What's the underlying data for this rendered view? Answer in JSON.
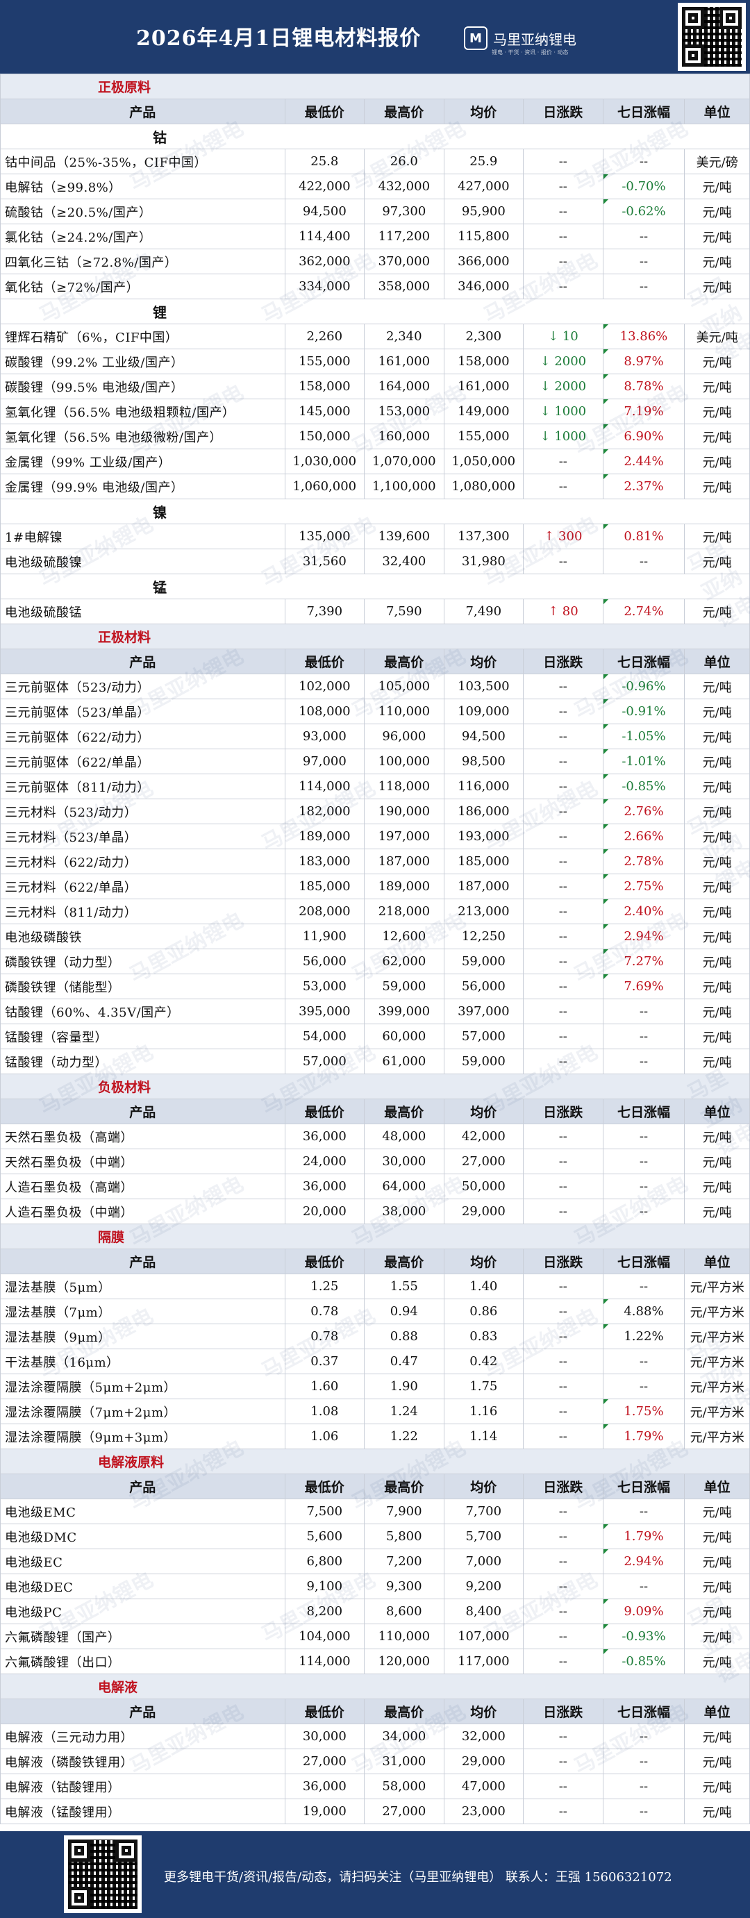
{
  "header": {
    "title": "2026年4月1日锂电材料报价",
    "brand": "马里亚纳锂电",
    "brand_sub": "锂电 · 干货 · 资讯 · 报价 · 动态",
    "qr_icon": "qr-code"
  },
  "footer": {
    "text": "更多锂电干货/资讯/报告/动态，请扫码关注（马里亚纳锂电） 联系人：王强 15606321072",
    "qr_icon": "qr-code"
  },
  "watermark": "马里亚纳锂电",
  "columns": [
    "产品",
    "最低价",
    "最高价",
    "均价",
    "日涨跌",
    "七日涨幅",
    "单位"
  ],
  "sections": [
    {
      "title": "正极原料",
      "groups": [
        {
          "name": "钴",
          "rows": [
            {
              "name": "钴中间品（25%-35%，CIF中国）",
              "low": "25.8",
              "high": "26.0",
              "avg": "25.9",
              "day": "--",
              "dayDir": "",
              "week": "--",
              "weekDir": "",
              "unit": "美元/磅"
            },
            {
              "name": "电解钴（≥99.8%）",
              "low": "422,000",
              "high": "432,000",
              "avg": "427,000",
              "day": "--",
              "dayDir": "",
              "week": "-0.70%",
              "weekDir": "down",
              "unit": "元/吨"
            },
            {
              "name": "硫酸钴（≥20.5%/国产）",
              "low": "94,500",
              "high": "97,300",
              "avg": "95,900",
              "day": "--",
              "dayDir": "",
              "week": "-0.62%",
              "weekDir": "down",
              "unit": "元/吨"
            },
            {
              "name": "氯化钴（≥24.2%/国产）",
              "low": "114,400",
              "high": "117,200",
              "avg": "115,800",
              "day": "--",
              "dayDir": "",
              "week": "--",
              "weekDir": "",
              "unit": "元/吨"
            },
            {
              "name": "四氧化三钴（≥72.8%/国产）",
              "low": "362,000",
              "high": "370,000",
              "avg": "366,000",
              "day": "--",
              "dayDir": "",
              "week": "--",
              "weekDir": "",
              "unit": "元/吨"
            },
            {
              "name": "氧化钴（≥72%/国产）",
              "low": "334,000",
              "high": "358,000",
              "avg": "346,000",
              "day": "--",
              "dayDir": "",
              "week": "--",
              "weekDir": "",
              "unit": "元/吨"
            }
          ]
        },
        {
          "name": "锂",
          "rows": [
            {
              "name": "锂辉石精矿（6%，CIF中国）",
              "low": "2,260",
              "high": "2,340",
              "avg": "2,300",
              "day": "10",
              "dayDir": "down",
              "week": "13.86%",
              "weekDir": "up",
              "unit": "美元/吨"
            },
            {
              "name": "碳酸锂（99.2% 工业级/国产）",
              "low": "155,000",
              "high": "161,000",
              "avg": "158,000",
              "day": "2000",
              "dayDir": "down",
              "week": "8.97%",
              "weekDir": "up",
              "unit": "元/吨"
            },
            {
              "name": "碳酸锂（99.5% 电池级/国产）",
              "low": "158,000",
              "high": "164,000",
              "avg": "161,000",
              "day": "2000",
              "dayDir": "down",
              "week": "8.78%",
              "weekDir": "up",
              "unit": "元/吨"
            },
            {
              "name": "氢氧化锂（56.5% 电池级粗颗粒/国产）",
              "low": "145,000",
              "high": "153,000",
              "avg": "149,000",
              "day": "1000",
              "dayDir": "down",
              "week": "7.19%",
              "weekDir": "up",
              "unit": "元/吨"
            },
            {
              "name": "氢氧化锂（56.5% 电池级微粉/国产）",
              "low": "150,000",
              "high": "160,000",
              "avg": "155,000",
              "day": "1000",
              "dayDir": "down",
              "week": "6.90%",
              "weekDir": "up",
              "unit": "元/吨"
            },
            {
              "name": "金属锂（99% 工业级/国产）",
              "low": "1,030,000",
              "high": "1,070,000",
              "avg": "1,050,000",
              "day": "--",
              "dayDir": "",
              "week": "2.44%",
              "weekDir": "up",
              "unit": "元/吨"
            },
            {
              "name": "金属锂（99.9% 电池级/国产）",
              "low": "1,060,000",
              "high": "1,100,000",
              "avg": "1,080,000",
              "day": "--",
              "dayDir": "",
              "week": "2.37%",
              "weekDir": "up",
              "unit": "元/吨"
            }
          ]
        },
        {
          "name": "镍",
          "rows": [
            {
              "name": "1#电解镍",
              "low": "135,000",
              "high": "139,600",
              "avg": "137,300",
              "day": "300",
              "dayDir": "up",
              "week": "0.81%",
              "weekDir": "up",
              "unit": "元/吨"
            },
            {
              "name": "电池级硫酸镍",
              "low": "31,560",
              "high": "32,400",
              "avg": "31,980",
              "day": "--",
              "dayDir": "",
              "week": "--",
              "weekDir": "",
              "unit": "元/吨"
            }
          ]
        },
        {
          "name": "锰",
          "rows": [
            {
              "name": "电池级硫酸锰",
              "low": "7,390",
              "high": "7,590",
              "avg": "7,490",
              "day": "80",
              "dayDir": "up",
              "week": "2.74%",
              "weekDir": "up",
              "unit": "元/吨"
            }
          ]
        }
      ]
    },
    {
      "title": "正极材料",
      "showHeader": true,
      "groups": [
        {
          "name": "",
          "rows": [
            {
              "name": "三元前驱体（523/动力）",
              "low": "102,000",
              "high": "105,000",
              "avg": "103,500",
              "day": "--",
              "dayDir": "",
              "week": "-0.96%",
              "weekDir": "down",
              "unit": "元/吨"
            },
            {
              "name": "三元前驱体（523/单晶）",
              "low": "108,000",
              "high": "110,000",
              "avg": "109,000",
              "day": "--",
              "dayDir": "",
              "week": "-0.91%",
              "weekDir": "down",
              "unit": "元/吨"
            },
            {
              "name": "三元前驱体（622/动力）",
              "low": "93,000",
              "high": "96,000",
              "avg": "94,500",
              "day": "--",
              "dayDir": "",
              "week": "-1.05%",
              "weekDir": "down",
              "unit": "元/吨"
            },
            {
              "name": "三元前驱体（622/单晶）",
              "low": "97,000",
              "high": "100,000",
              "avg": "98,500",
              "day": "--",
              "dayDir": "",
              "week": "-1.01%",
              "weekDir": "down",
              "unit": "元/吨"
            },
            {
              "name": "三元前驱体（811/动力）",
              "low": "114,000",
              "high": "118,000",
              "avg": "116,000",
              "day": "--",
              "dayDir": "",
              "week": "-0.85%",
              "weekDir": "down",
              "unit": "元/吨"
            },
            {
              "name": "三元材料（523/动力）",
              "low": "182,000",
              "high": "190,000",
              "avg": "186,000",
              "day": "--",
              "dayDir": "",
              "week": "2.76%",
              "weekDir": "up",
              "unit": "元/吨"
            },
            {
              "name": "三元材料（523/单晶）",
              "low": "189,000",
              "high": "197,000",
              "avg": "193,000",
              "day": "--",
              "dayDir": "",
              "week": "2.66%",
              "weekDir": "up",
              "unit": "元/吨"
            },
            {
              "name": "三元材料（622/动力）",
              "low": "183,000",
              "high": "187,000",
              "avg": "185,000",
              "day": "--",
              "dayDir": "",
              "week": "2.78%",
              "weekDir": "up",
              "unit": "元/吨"
            },
            {
              "name": "三元材料（622/单晶）",
              "low": "185,000",
              "high": "189,000",
              "avg": "187,000",
              "day": "--",
              "dayDir": "",
              "week": "2.75%",
              "weekDir": "up",
              "unit": "元/吨"
            },
            {
              "name": "三元材料（811/动力）",
              "low": "208,000",
              "high": "218,000",
              "avg": "213,000",
              "day": "--",
              "dayDir": "",
              "week": "2.40%",
              "weekDir": "up",
              "unit": "元/吨"
            },
            {
              "name": "电池级磷酸铁",
              "low": "11,900",
              "high": "12,600",
              "avg": "12,250",
              "day": "--",
              "dayDir": "",
              "week": "2.94%",
              "weekDir": "up",
              "unit": "元/吨"
            },
            {
              "name": "磷酸铁锂（动力型）",
              "low": "56,000",
              "high": "62,000",
              "avg": "59,000",
              "day": "--",
              "dayDir": "",
              "week": "7.27%",
              "weekDir": "up",
              "unit": "元/吨"
            },
            {
              "name": "磷酸铁锂（储能型）",
              "low": "53,000",
              "high": "59,000",
              "avg": "56,000",
              "day": "--",
              "dayDir": "",
              "week": "7.69%",
              "weekDir": "up",
              "unit": "元/吨"
            },
            {
              "name": "钴酸锂（60%、4.35V/国产）",
              "low": "395,000",
              "high": "399,000",
              "avg": "397,000",
              "day": "--",
              "dayDir": "",
              "week": "--",
              "weekDir": "",
              "unit": "元/吨"
            },
            {
              "name": "锰酸锂（容量型）",
              "low": "54,000",
              "high": "60,000",
              "avg": "57,000",
              "day": "--",
              "dayDir": "",
              "week": "--",
              "weekDir": "",
              "unit": "元/吨"
            },
            {
              "name": "锰酸锂（动力型）",
              "low": "57,000",
              "high": "61,000",
              "avg": "59,000",
              "day": "--",
              "dayDir": "",
              "week": "--",
              "weekDir": "",
              "unit": "元/吨"
            }
          ]
        }
      ]
    },
    {
      "title": "负极材料",
      "showHeader": true,
      "groups": [
        {
          "name": "",
          "rows": [
            {
              "name": "天然石墨负极（高端）",
              "low": "36,000",
              "high": "48,000",
              "avg": "42,000",
              "day": "--",
              "dayDir": "",
              "week": "--",
              "weekDir": "",
              "unit": "元/吨"
            },
            {
              "name": "天然石墨负极（中端）",
              "low": "24,000",
              "high": "30,000",
              "avg": "27,000",
              "day": "--",
              "dayDir": "",
              "week": "--",
              "weekDir": "",
              "unit": "元/吨"
            },
            {
              "name": "人造石墨负极（高端）",
              "low": "36,000",
              "high": "64,000",
              "avg": "50,000",
              "day": "--",
              "dayDir": "",
              "week": "--",
              "weekDir": "",
              "unit": "元/吨"
            },
            {
              "name": "人造石墨负极（中端）",
              "low": "20,000",
              "high": "38,000",
              "avg": "29,000",
              "day": "--",
              "dayDir": "",
              "week": "--",
              "weekDir": "",
              "unit": "元/吨"
            }
          ]
        }
      ]
    },
    {
      "title": "隔膜",
      "showHeader": true,
      "groups": [
        {
          "name": "",
          "rows": [
            {
              "name": "湿法基膜（5μm）",
              "low": "1.25",
              "high": "1.55",
              "avg": "1.40",
              "day": "--",
              "dayDir": "",
              "week": "--",
              "weekDir": "",
              "unit": "元/平方米"
            },
            {
              "name": "湿法基膜（7μm）",
              "low": "0.78",
              "high": "0.94",
              "avg": "0.86",
              "day": "--",
              "dayDir": "",
              "week": "4.88%",
              "weekDir": "plain",
              "unit": "元/平方米"
            },
            {
              "name": "湿法基膜（9μm）",
              "low": "0.78",
              "high": "0.88",
              "avg": "0.83",
              "day": "--",
              "dayDir": "",
              "week": "1.22%",
              "weekDir": "plain",
              "unit": "元/平方米"
            },
            {
              "name": "干法基膜（16μm）",
              "low": "0.37",
              "high": "0.47",
              "avg": "0.42",
              "day": "--",
              "dayDir": "",
              "week": "--",
              "weekDir": "",
              "unit": "元/平方米"
            },
            {
              "name": "湿法涂覆隔膜（5μm+2μm）",
              "low": "1.60",
              "high": "1.90",
              "avg": "1.75",
              "day": "--",
              "dayDir": "",
              "week": "--",
              "weekDir": "",
              "unit": "元/平方米"
            },
            {
              "name": "湿法涂覆隔膜（7μm+2μm）",
              "low": "1.08",
              "high": "1.24",
              "avg": "1.16",
              "day": "--",
              "dayDir": "",
              "week": "1.75%",
              "weekDir": "up",
              "unit": "元/平方米"
            },
            {
              "name": "湿法涂覆隔膜（9μm+3μm）",
              "low": "1.06",
              "high": "1.22",
              "avg": "1.14",
              "day": "--",
              "dayDir": "",
              "week": "1.79%",
              "weekDir": "up",
              "unit": "元/平方米"
            }
          ]
        }
      ]
    },
    {
      "title": "电解液原料",
      "showHeader": true,
      "groups": [
        {
          "name": "",
          "rows": [
            {
              "name": "电池级EMC",
              "low": "7,500",
              "high": "7,900",
              "avg": "7,700",
              "day": "--",
              "dayDir": "",
              "week": "--",
              "weekDir": "",
              "unit": "元/吨"
            },
            {
              "name": "电池级DMC",
              "low": "5,600",
              "high": "5,800",
              "avg": "5,700",
              "day": "--",
              "dayDir": "",
              "week": "1.79%",
              "weekDir": "up",
              "unit": "元/吨"
            },
            {
              "name": "电池级EC",
              "low": "6,800",
              "high": "7,200",
              "avg": "7,000",
              "day": "--",
              "dayDir": "",
              "week": "2.94%",
              "weekDir": "up",
              "unit": "元/吨"
            },
            {
              "name": "电池级DEC",
              "low": "9,100",
              "high": "9,300",
              "avg": "9,200",
              "day": "--",
              "dayDir": "",
              "week": "--",
              "weekDir": "",
              "unit": "元/吨"
            },
            {
              "name": "电池级PC",
              "low": "8,200",
              "high": "8,600",
              "avg": "8,400",
              "day": "--",
              "dayDir": "",
              "week": "9.09%",
              "weekDir": "up",
              "unit": "元/吨"
            },
            {
              "name": "六氟磷酸锂（国产）",
              "low": "104,000",
              "high": "110,000",
              "avg": "107,000",
              "day": "--",
              "dayDir": "",
              "week": "-0.93%",
              "weekDir": "down",
              "unit": "元/吨"
            },
            {
              "name": "六氟磷酸锂（出口）",
              "low": "114,000",
              "high": "120,000",
              "avg": "117,000",
              "day": "--",
              "dayDir": "",
              "week": "-0.85%",
              "weekDir": "down",
              "unit": "元/吨"
            }
          ]
        }
      ]
    },
    {
      "title": "电解液",
      "showHeader": true,
      "groups": [
        {
          "name": "",
          "rows": [
            {
              "name": "电解液（三元动力用）",
              "low": "30,000",
              "high": "34,000",
              "avg": "32,000",
              "day": "--",
              "dayDir": "",
              "week": "--",
              "weekDir": "",
              "unit": "元/吨"
            },
            {
              "name": "电解液（磷酸铁锂用）",
              "low": "27,000",
              "high": "31,000",
              "avg": "29,000",
              "day": "--",
              "dayDir": "",
              "week": "--",
              "weekDir": "",
              "unit": "元/吨"
            },
            {
              "name": "电解液（钴酸锂用）",
              "low": "36,000",
              "high": "58,000",
              "avg": "47,000",
              "day": "--",
              "dayDir": "",
              "week": "--",
              "weekDir": "",
              "unit": "元/吨"
            },
            {
              "name": "电解液（锰酸锂用）",
              "low": "19,000",
              "high": "27,000",
              "avg": "23,000",
              "day": "--",
              "dayDir": "",
              "week": "--",
              "weekDir": "",
              "unit": "元/吨"
            }
          ]
        }
      ]
    }
  ]
}
